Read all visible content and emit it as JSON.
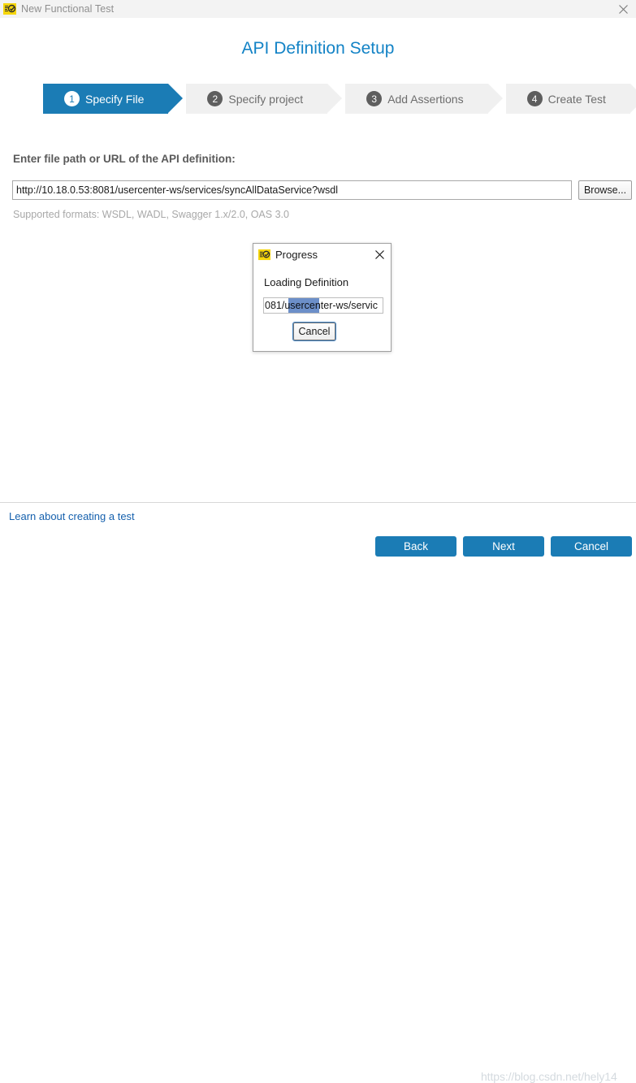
{
  "window": {
    "title": "New Functional Test",
    "icon": "soapui-test-icon",
    "close_icon": "close-icon"
  },
  "page": {
    "title": "API Definition Setup",
    "accent_color": "#1383c6",
    "step_active_color": "#1b7cb5",
    "step_inactive_bg": "#f0f0f0"
  },
  "steps": [
    {
      "num": "1",
      "label": "Specify File",
      "state": "active"
    },
    {
      "num": "2",
      "label": "Specify project",
      "state": "inactive"
    },
    {
      "num": "3",
      "label": "Add Assertions",
      "state": "inactive"
    },
    {
      "num": "4",
      "label": "Create Test",
      "state": "inactive"
    }
  ],
  "form": {
    "label": "Enter file path or URL of the API definition:",
    "url_value": "http://10.18.0.53:8081/usercenter-ws/services/syncAllDataService?wsdl",
    "url_placeholder": "http://",
    "browse_label": "Browse...",
    "formats_note": "Supported formats: WSDL, WADL, Swagger 1.x/2.0, OAS 3.0"
  },
  "modal": {
    "icon": "soapui-test-icon",
    "title": "Progress",
    "close_icon": "close-icon",
    "message": "Loading Definition",
    "progress_text": "081/usercenter-ws/servic",
    "progress_highlight_color": "#6c8fc9",
    "cancel_label": "Cancel"
  },
  "footer": {
    "learn_link": "Learn about creating a test",
    "learn_link_color": "#1560ad",
    "back_label": "Back",
    "next_label": "Next",
    "cancel_label": "Cancel",
    "watermark": "https://blog.csdn.net/hely14"
  }
}
